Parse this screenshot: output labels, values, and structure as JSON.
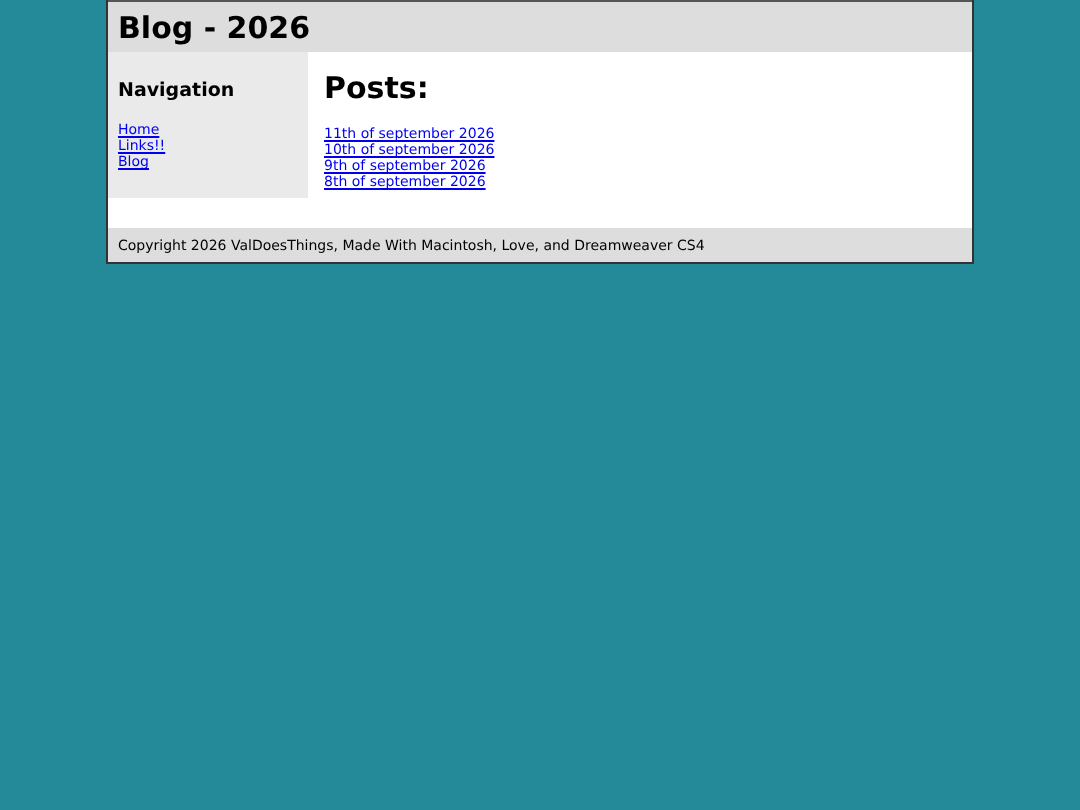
{
  "header": {
    "title": "Blog - 2026"
  },
  "sidebar": {
    "heading": "Navigation",
    "links": [
      "Home",
      "Links!!",
      "Blog"
    ]
  },
  "main": {
    "heading": "Posts:",
    "posts": [
      "11th of september 2026",
      "10th of september 2026",
      "9th of september 2026",
      "8th of september 2026"
    ]
  },
  "footer": {
    "text": "Copyright 2026 ValDoesThings, Made With Macintosh, Love, and Dreamweaver CS4"
  }
}
